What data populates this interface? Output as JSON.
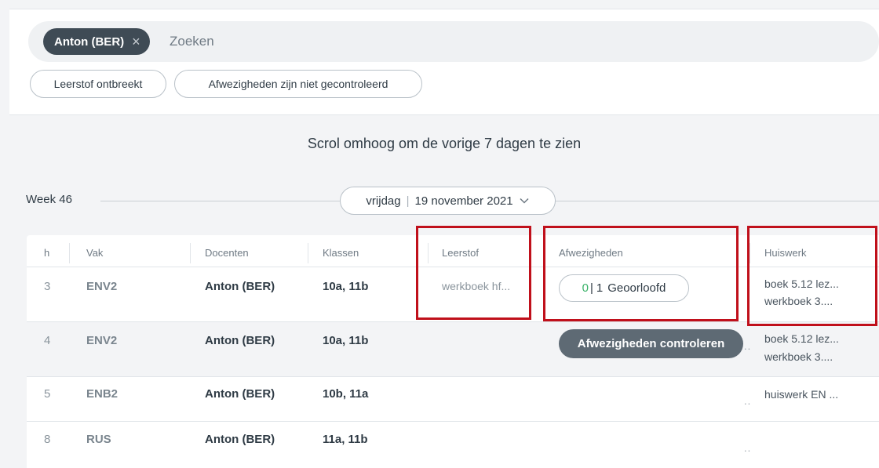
{
  "search": {
    "chip_label": "Anton (BER)",
    "chip_remove_glyph": "×",
    "placeholder": "Zoeken",
    "value": ""
  },
  "filters": [
    {
      "label": "Leerstof ontbreekt"
    },
    {
      "label": "Afwezigheden zijn niet gecontroleerd"
    }
  ],
  "scroll_hint": "Scrol omhoog om de vorige 7 dagen te zien",
  "week": {
    "label": "Week 46",
    "day": "vrijdag",
    "separator": "|",
    "date": "19 november 2021"
  },
  "table": {
    "headers": {
      "h": "h",
      "vak": "Vak",
      "docenten": "Docenten",
      "klassen": "Klassen",
      "leerstof": "Leerstof",
      "afwezigheden": "Afwezigheden",
      "huiswerk": "Huiswerk"
    },
    "rows": [
      {
        "h": "3",
        "vak": "ENV2",
        "docenten": "Anton (BER)",
        "klassen": "10a, 11b",
        "leerstof": "werkboek hf...",
        "huiswerk_1": "boek 5.12 lez...",
        "huiswerk_2": "werkboek 3...."
      },
      {
        "h": "4",
        "vak": "ENV2",
        "docenten": "Anton (BER)",
        "klassen": "10a, 11b",
        "leerstof": "",
        "huiswerk_1": "boek 5.12 lez...",
        "huiswerk_2": "werkboek 3...."
      },
      {
        "h": "5",
        "vak": "ENB2",
        "docenten": "Anton (BER)",
        "klassen": "10b, 11a",
        "leerstof": "",
        "huiswerk_1": "huiswerk EN ...",
        "huiswerk_2": ""
      },
      {
        "h": "8",
        "vak": "RUS",
        "docenten": "Anton (BER)",
        "klassen": "11a, 11b",
        "leerstof": "",
        "huiswerk_1": "",
        "huiswerk_2": ""
      }
    ],
    "truncation_dots": ".."
  },
  "absence_status": {
    "present": "0",
    "separator": "|",
    "count": "1",
    "label": "Geoorloofd",
    "present_color": "#3bb36a"
  },
  "check_button": {
    "label": "Afwezigheden controleren"
  },
  "colors": {
    "accent_dark": "#3f4b55",
    "button_gray": "#5e6a74",
    "annotation_red": "#c0101b"
  }
}
